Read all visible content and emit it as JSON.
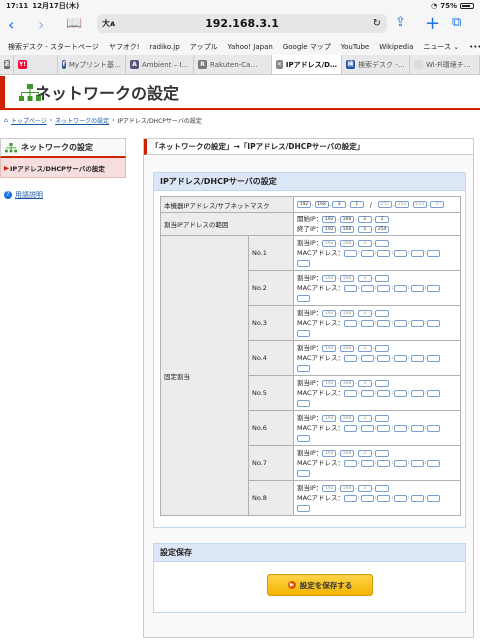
{
  "status": {
    "time": "17:11",
    "date": "12月17日(木)",
    "battery": "75%"
  },
  "browser": {
    "url": "192.168.3.1",
    "text_size": "大ᴀ",
    "bookmarks": [
      "検索デスク - スタートページ",
      "ヤフオク!",
      "radiko.jp",
      "アップル",
      "Yahoo! Japan",
      "Google マップ",
      "YouTube",
      "Wikipedia",
      "ニュース ⌄"
    ],
    "tabs": [
      {
        "label": "",
        "fav": "あ",
        "color": "#666666",
        "active": false
      },
      {
        "label": "",
        "fav": "Y!",
        "color": "#ff0033",
        "active": false
      },
      {
        "label": "Myプリント基…",
        "fav": "f",
        "color": "#3b5998",
        "active": false
      },
      {
        "label": "Ambient – I…",
        "fav": "A",
        "color": "#555577",
        "active": false
      },
      {
        "label": "Rakuten-Ca…",
        "fav": "R",
        "color": "#777777",
        "active": false
      },
      {
        "label": "IPアドレス/D…",
        "fav": "✕",
        "color": "#888888",
        "active": true
      },
      {
        "label": "検索デスク -…",
        "fav": "検",
        "color": "#2255aa",
        "active": false
      },
      {
        "label": "Wi-Fi環境チ…",
        "fav": "",
        "color": "#dddddd",
        "active": false
      }
    ]
  },
  "header": {
    "title": "ネットワークの設定"
  },
  "breadcrumb": {
    "top": "トップページ",
    "network": "ネットワークの設定",
    "current": "IPアドレス/DHCPサーバの設定"
  },
  "sidebar": {
    "heading": "ネットワークの設定",
    "item": "IPアドレス/DHCPサーバの設定",
    "help": "用語説明"
  },
  "main": {
    "title": "「ネットワークの設定」→「IPアドレス/DHCPサーバの設定」",
    "section_title": "IPアドレス/DHCPサーバの設定",
    "device_ip_label": "本機器IPアドレス/サブネットマスク",
    "device_ip": [
      "192",
      "168",
      "3",
      "1"
    ],
    "subnet": [
      "255",
      "255",
      "255",
      "0"
    ],
    "range_label": "割当IPアドレスの範囲",
    "start_label": "開始IP：",
    "start_ip": [
      "192",
      "168",
      "3",
      "2"
    ],
    "end_label": "終了IP：",
    "end_ip": [
      "192",
      "168",
      "3",
      "254"
    ],
    "fixed_label": "固定割当",
    "assign_label": "割当IP：",
    "mac_label": "MACアドレス：",
    "fixed_ip_placeholder": [
      "192",
      "168",
      "3",
      ""
    ],
    "rows": [
      "No.1",
      "No.2",
      "No.3",
      "No.4",
      "No.5",
      "No.6",
      "No.7",
      "No.8"
    ],
    "save_section": "設定保存",
    "save_button": "設定を保存する"
  }
}
